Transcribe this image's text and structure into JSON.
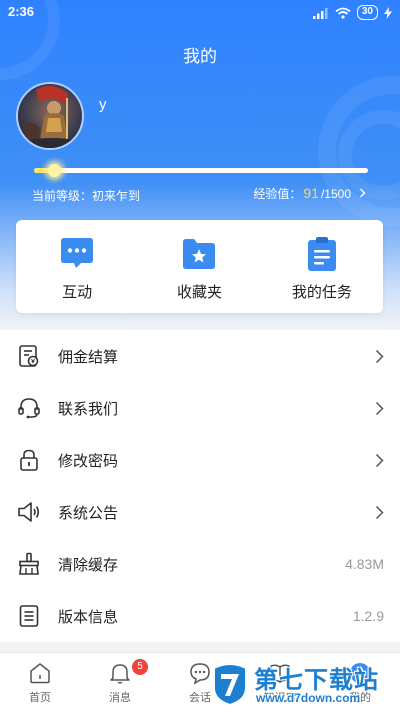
{
  "status_bar": {
    "time": "2:36",
    "battery": "30"
  },
  "header": {
    "title": "我的"
  },
  "profile": {
    "username": "y",
    "level_text": "当前等级：初来乍到",
    "exp_label": "经验值：",
    "exp_value": "91",
    "exp_max": "/1500",
    "progress_fraction": 0.06
  },
  "quick_actions": [
    {
      "label": "互动",
      "icon": "chat-bubble-icon"
    },
    {
      "label": "收藏夹",
      "icon": "star-folder-icon"
    },
    {
      "label": "我的任务",
      "icon": "clipboard-icon"
    }
  ],
  "menu": {
    "items": [
      {
        "label": "佣金结算",
        "icon": "commission-icon",
        "value": ""
      },
      {
        "label": "联系我们",
        "icon": "headset-icon",
        "value": ""
      },
      {
        "label": "修改密码",
        "icon": "lock-icon",
        "value": ""
      },
      {
        "label": "系统公告",
        "icon": "speaker-icon",
        "value": ""
      },
      {
        "label": "清除缓存",
        "icon": "broom-icon",
        "value": "4.83M"
      },
      {
        "label": "版本信息",
        "icon": "document-icon",
        "value": "1.2.9"
      }
    ]
  },
  "tabbar": {
    "tabs": [
      {
        "label": "首页",
        "icon": "home-icon"
      },
      {
        "label": "消息",
        "icon": "bell-icon",
        "badge": "5"
      },
      {
        "label": "会话",
        "icon": "conversation-icon"
      },
      {
        "label": "知识库",
        "icon": "knowledge-icon"
      },
      {
        "label": "我的",
        "icon": "profile-icon"
      }
    ]
  },
  "watermark": {
    "title": "第七下载站",
    "url": "www.d7down.com"
  },
  "colors": {
    "primary": "#2f82ff",
    "accent_yellow": "#ffd84d",
    "badge_red": "#f0433a",
    "watermark_blue": "#1d7fd0"
  }
}
